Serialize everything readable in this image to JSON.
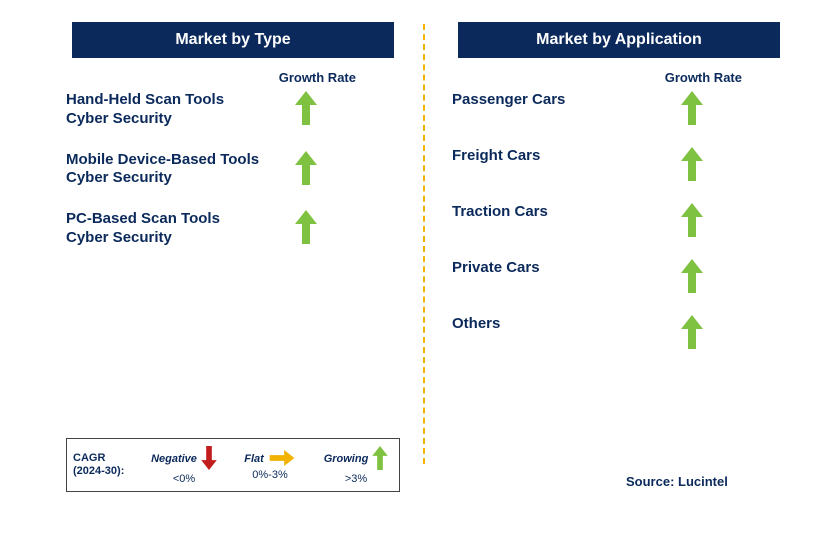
{
  "left": {
    "title": "Market by Type",
    "growth_rate_label": "Growth Rate",
    "items": [
      {
        "label": "Hand-Held Scan Tools Cyber Security",
        "trend": "growing"
      },
      {
        "label": "Mobile Device-Based Tools Cyber Security",
        "trend": "growing"
      },
      {
        "label": "PC-Based Scan Tools Cyber Security",
        "trend": "growing"
      }
    ]
  },
  "right": {
    "title": "Market by Application",
    "growth_rate_label": "Growth Rate",
    "items": [
      {
        "label": "Passenger Cars",
        "trend": "growing"
      },
      {
        "label": "Freight Cars",
        "trend": "growing"
      },
      {
        "label": "Traction Cars",
        "trend": "growing"
      },
      {
        "label": "Private Cars",
        "trend": "growing"
      },
      {
        "label": "Others",
        "trend": "growing"
      }
    ]
  },
  "legend": {
    "cagr_line1": "CAGR",
    "cagr_line2": "(2024-30):",
    "negative": {
      "label": "Negative",
      "range": "<0%"
    },
    "flat": {
      "label": "Flat",
      "range": "0%-3%"
    },
    "growing": {
      "label": "Growing",
      "range": ">3%"
    }
  },
  "source": "Source: Lucintel",
  "colors": {
    "navy": "#0b2a5b",
    "green": "#7fc241",
    "red": "#c11d1d",
    "yellow": "#f1b200"
  }
}
